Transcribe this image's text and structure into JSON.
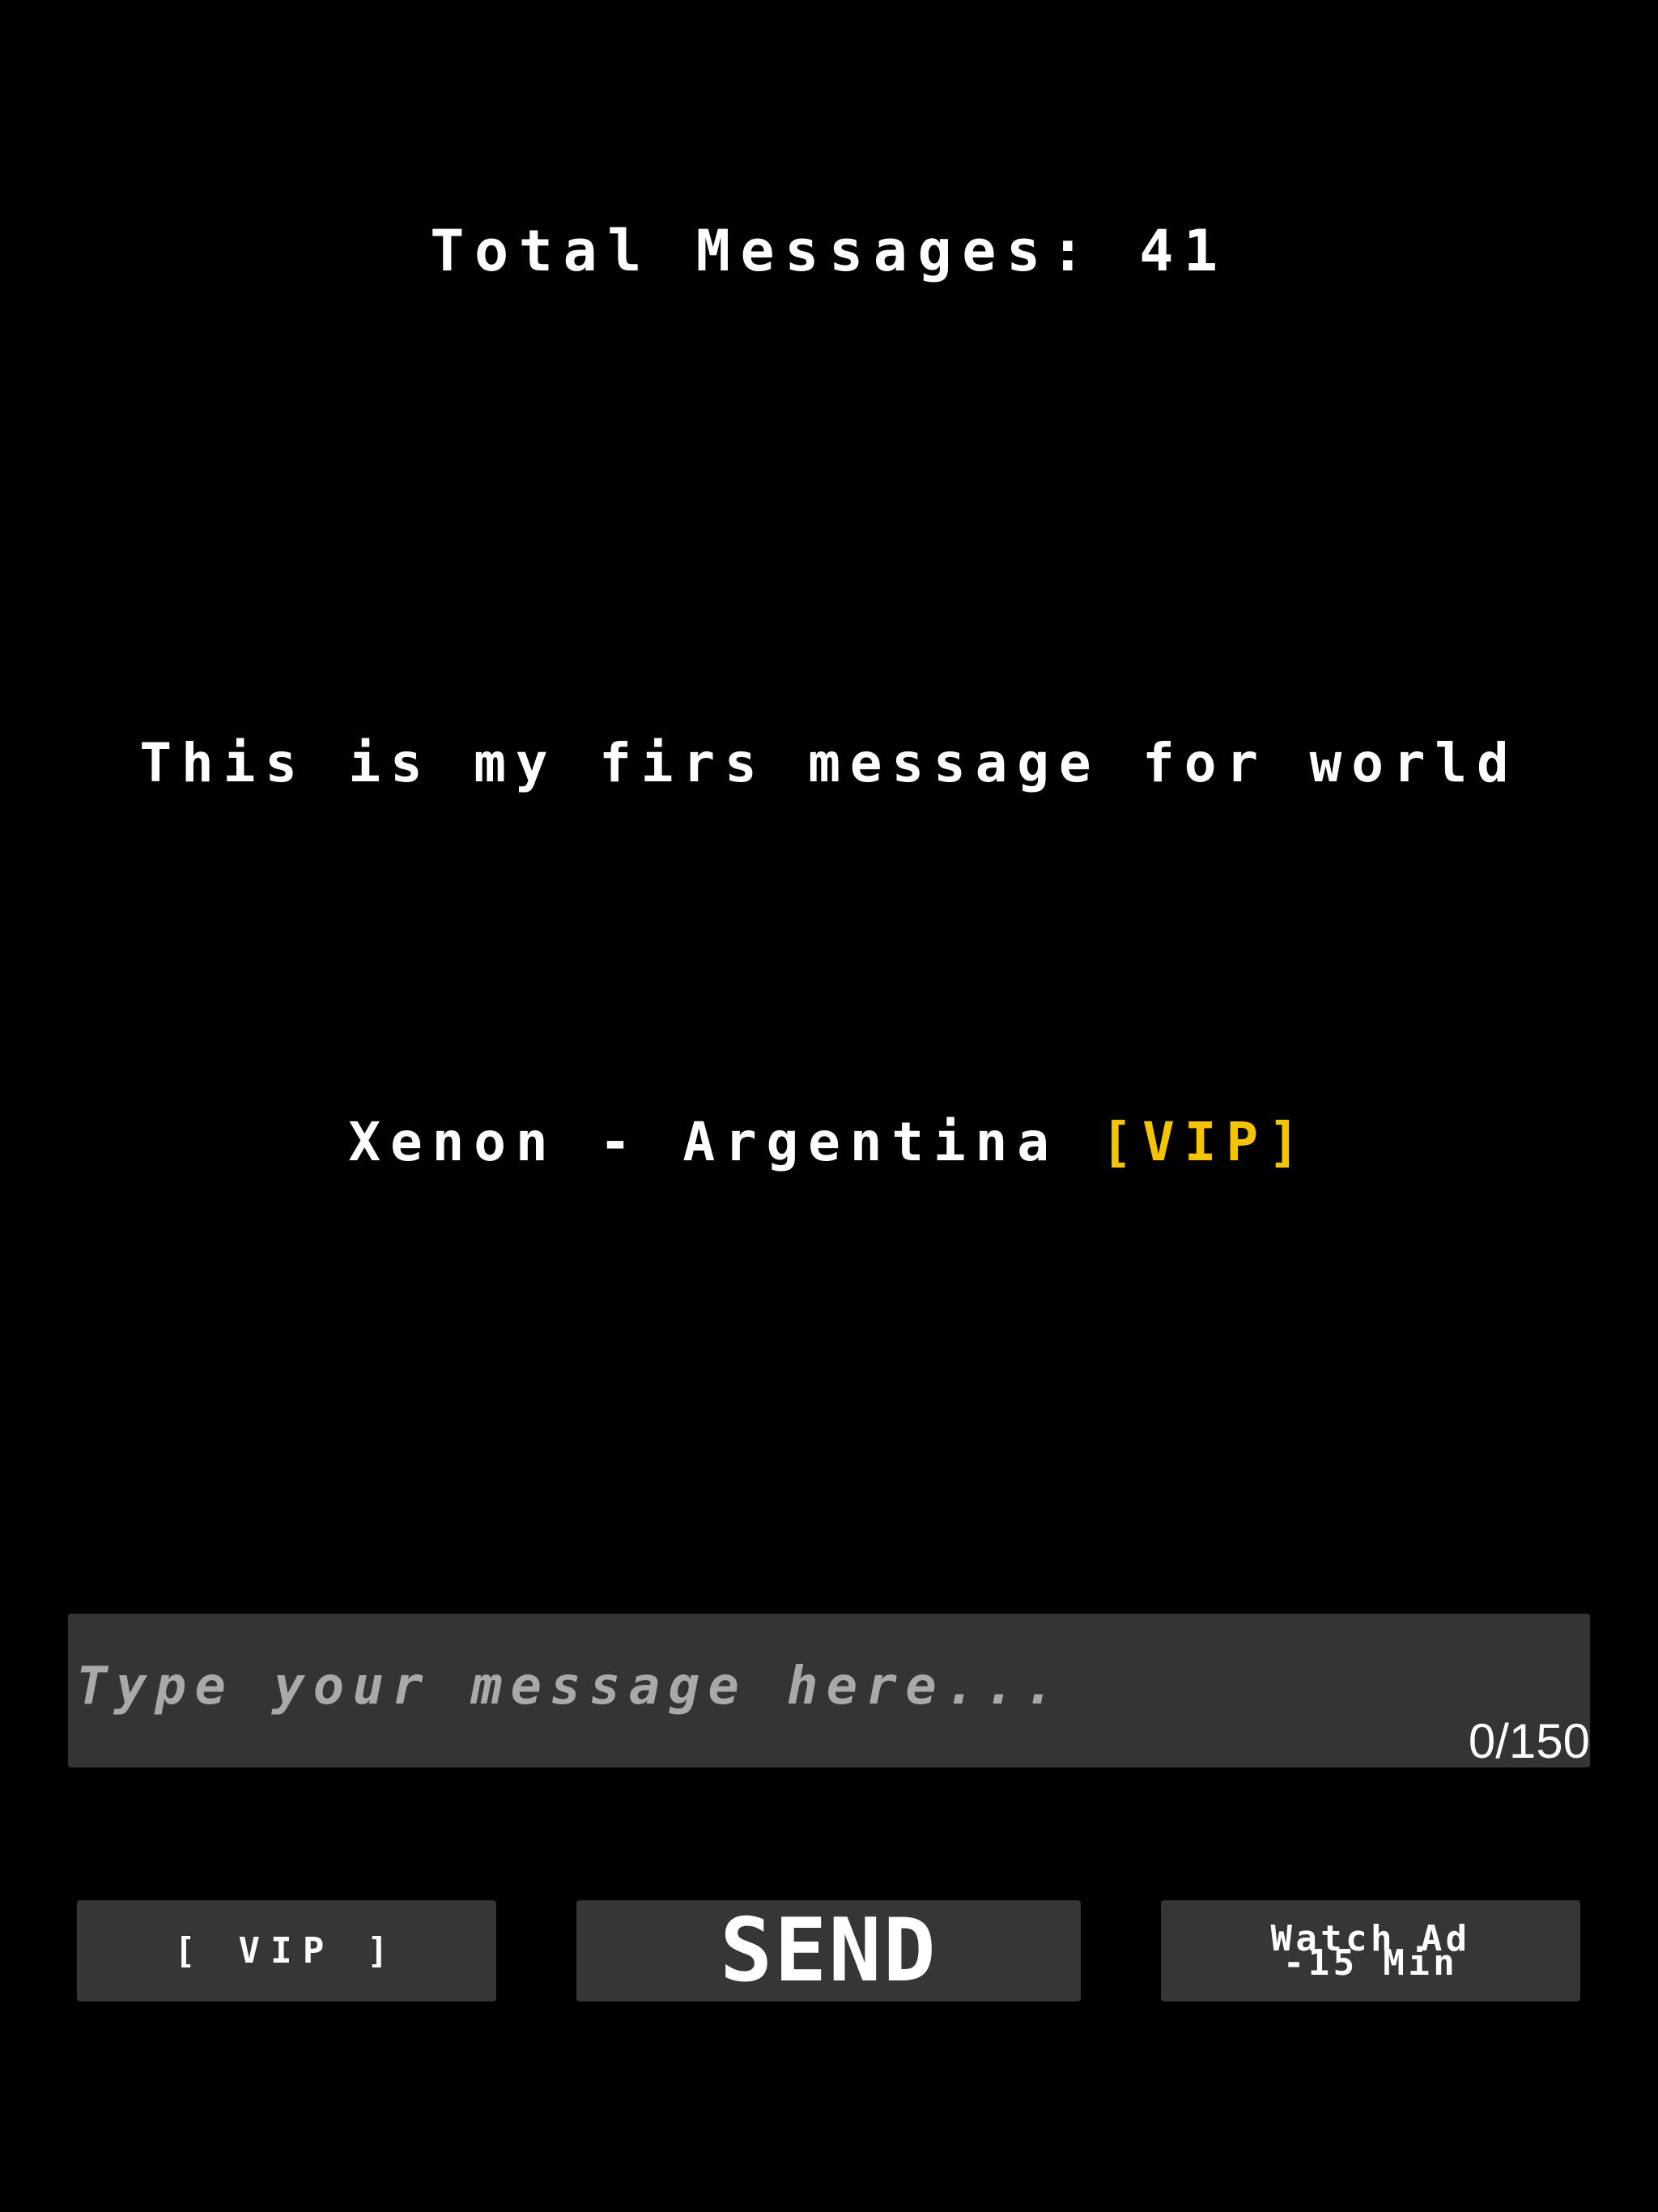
{
  "header": {
    "total_messages_label": "Total Messages:",
    "total_messages_count": "41"
  },
  "message": {
    "text": "This is my firs message for world",
    "author": "Xenon - Argentina",
    "author_badge": "[VIP]"
  },
  "composer": {
    "placeholder": "Type your message here...",
    "value": "",
    "char_counter": "0/150"
  },
  "buttons": {
    "vip_label": "[ VIP ]",
    "send_label": "SEND",
    "watch_ad_line1": "Watch Ad",
    "watch_ad_line2": "-15 Min"
  },
  "colors": {
    "background": "#000000",
    "panel": "#343434",
    "text": "#ffffff",
    "vip_accent": "#f5c400",
    "placeholder": "#a9a9a9"
  }
}
